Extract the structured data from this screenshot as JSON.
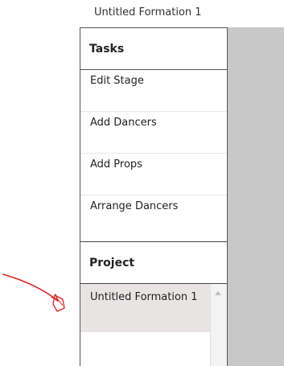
{
  "window": {
    "title": "Untitled Formation 1"
  },
  "tasks": {
    "header": "Tasks",
    "items": [
      {
        "label": "Edit Stage"
      },
      {
        "label": "Add Dancers"
      },
      {
        "label": "Add Props"
      },
      {
        "label": "Arrange Dancers"
      }
    ]
  },
  "project": {
    "header": "Project",
    "items": [
      {
        "label": "Untitled Formation 1",
        "selected": true
      }
    ]
  },
  "colors": {
    "selection": "#e7e4e3",
    "canvas_background": "#c8c8c8",
    "annotation": "#e02020"
  }
}
